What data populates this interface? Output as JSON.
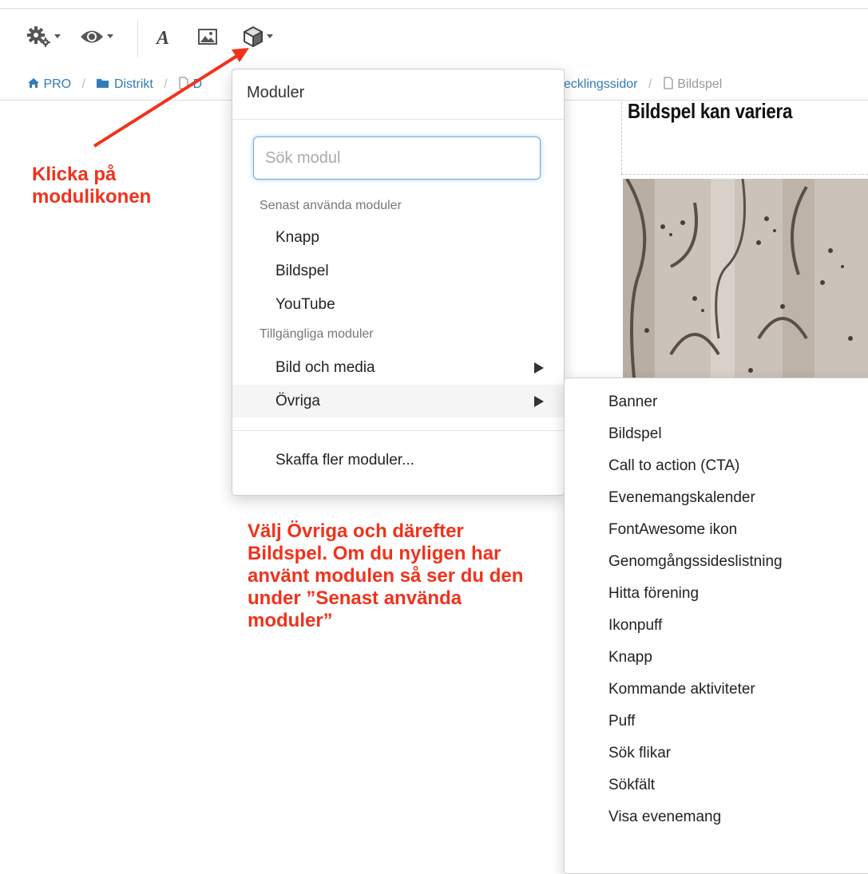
{
  "toolbar": {
    "icons": [
      "gears-icon",
      "eye-icon",
      "text-format-icon",
      "image-icon",
      "cube-module-icon"
    ],
    "text_tool_label": "A"
  },
  "breadcrumb": {
    "items": [
      "PRO",
      "Distrikt",
      "D",
      "ecklingssidor",
      "Bildspel"
    ]
  },
  "page": {
    "title": "Bildspel kan variera"
  },
  "annotations": {
    "click_module_icon": "Klicka på modulikonen",
    "choose_other": "Välj Övriga och därefter Bildspel. Om du nyligen har använt modulen så ser du den under ”Senast använda moduler”"
  },
  "menu": {
    "header": "Moduler",
    "search_placeholder": "Sök modul",
    "recent_label": "Senast använda moduler",
    "recent_items": [
      "Knapp",
      "Bildspel",
      "YouTube"
    ],
    "available_label": "Tillgängliga moduler",
    "available_items": [
      "Bild och media",
      "Övriga"
    ],
    "more": "Skaffa fler moduler..."
  },
  "submenu": {
    "items": [
      "Banner",
      "Bildspel",
      "Call to action (CTA)",
      "Evenemangskalender",
      "FontAwesome ikon",
      "Genomgångssideslistning",
      "Hitta förening",
      "Ikonpuff",
      "Knapp",
      "Kommande aktiviteter",
      "Puff",
      "Sök flikar",
      "Sökfält",
      "Visa evenemang"
    ]
  },
  "colors": {
    "annotation": "#f0321c",
    "link": "#337ab7",
    "focus": "#6fa8dc"
  }
}
